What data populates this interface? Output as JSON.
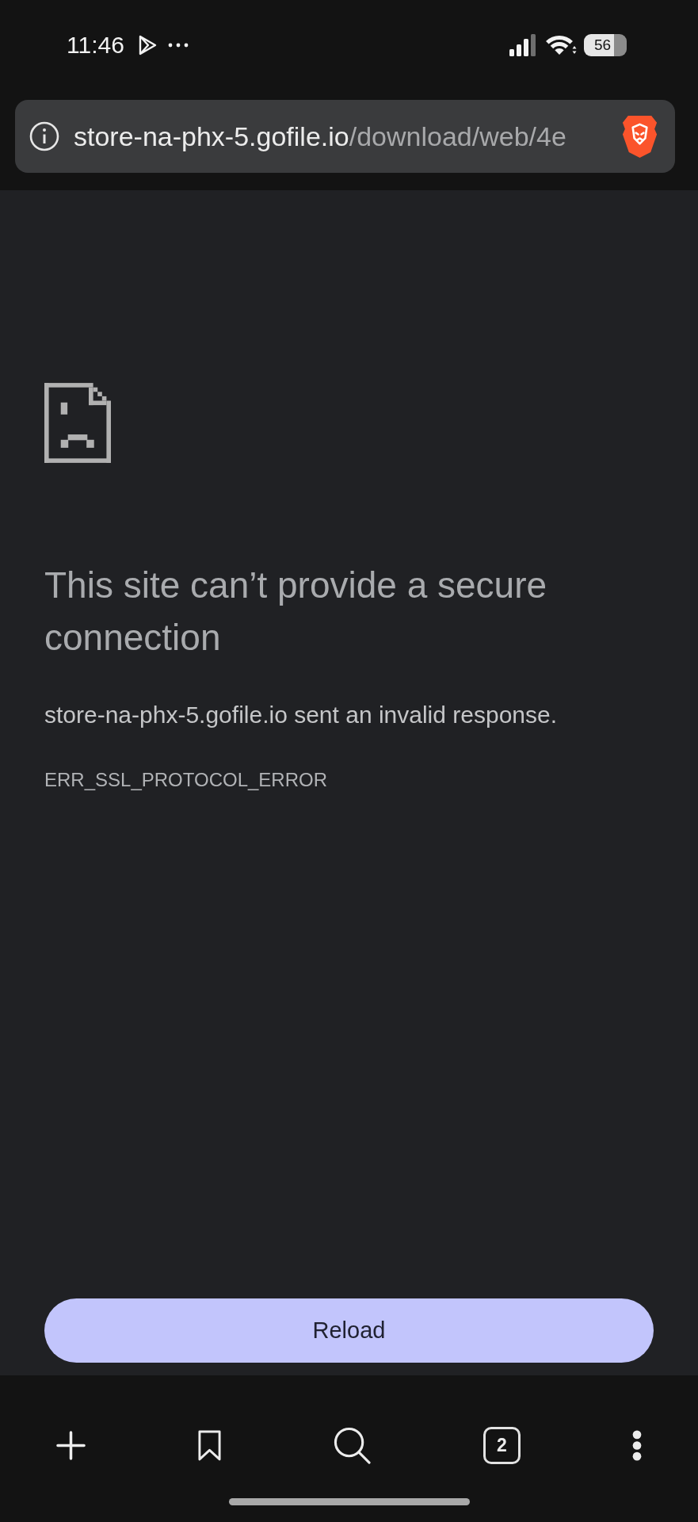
{
  "status_bar": {
    "time": "11:46",
    "battery": "56"
  },
  "address_bar": {
    "host": "store-na-phx-5.gofile.io",
    "path": "/download/web/4e"
  },
  "error_page": {
    "title": "This site can’t provide a secure connection",
    "message": "store-na-phx-5.gofile.io sent an invalid response.",
    "error_code": "ERR_SSL_PROTOCOL_ERROR",
    "button": "Reload"
  },
  "toolbar": [
    {
      "kind": "new_tab"
    },
    {
      "kind": "bookmarks"
    },
    {
      "kind": "search"
    },
    {
      "kind": "tabs",
      "count": "2"
    },
    {
      "kind": "menu"
    }
  ]
}
